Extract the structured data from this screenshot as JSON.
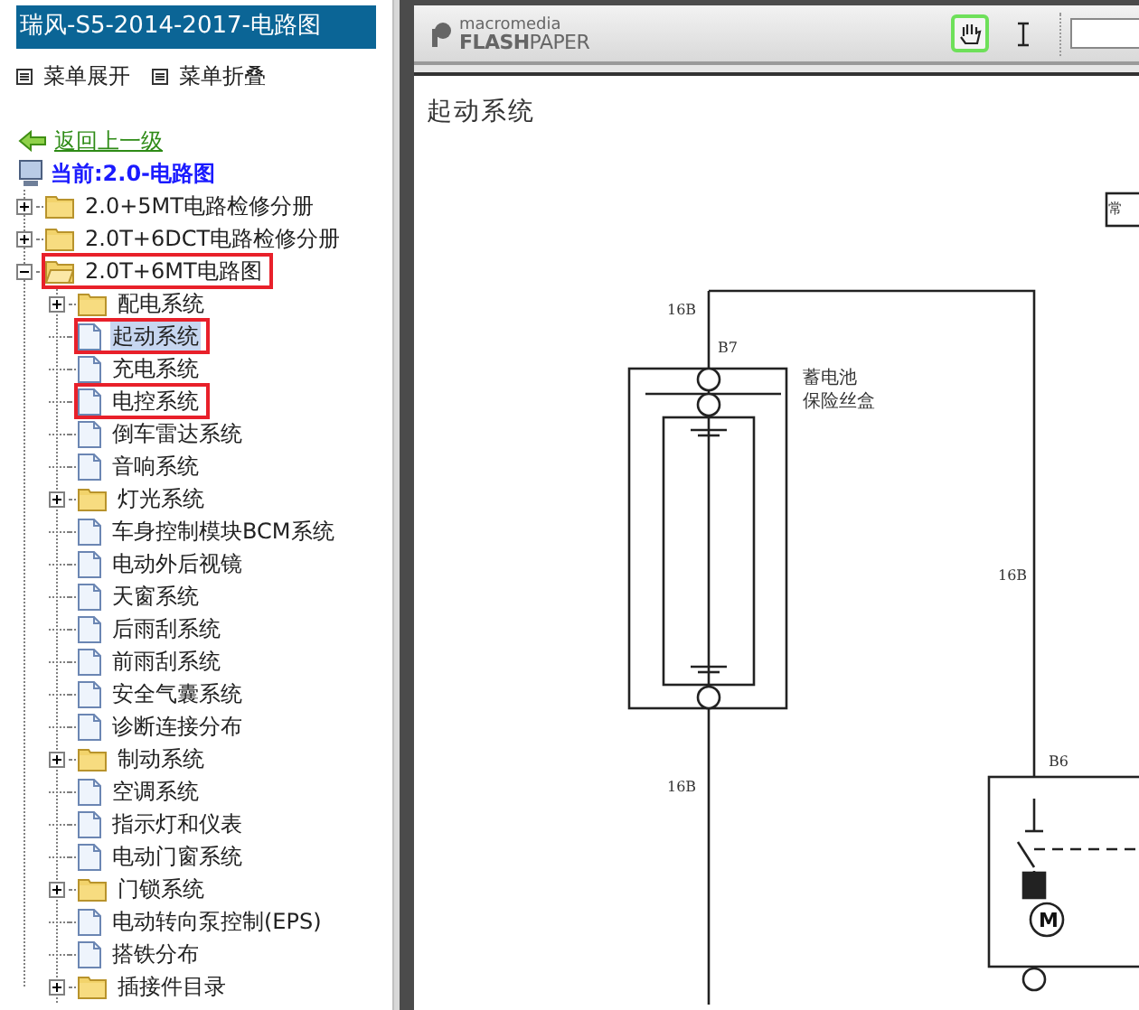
{
  "sidebar": {
    "title": "瑞风-S5-2014-2017-电路图",
    "menu": [
      {
        "label": "菜单展开"
      },
      {
        "label": "菜单折叠"
      }
    ],
    "back_link": "返回上一级",
    "current": "当前:2.0-电路图",
    "tree": [
      {
        "label": "2.0+5MT电路检修分册",
        "kind": "folder",
        "expanded": false,
        "selected": false,
        "boxed": false
      },
      {
        "label": "2.0T+6DCT电路检修分册",
        "kind": "folder",
        "expanded": false,
        "selected": false,
        "boxed": false
      },
      {
        "label": "2.0T+6MT电路图",
        "kind": "folder",
        "expanded": true,
        "selected": false,
        "boxed": true,
        "children": [
          {
            "label": "配电系统",
            "kind": "folder",
            "expanded": false,
            "selected": false,
            "boxed": false
          },
          {
            "label": "起动系统",
            "kind": "file",
            "selected": true,
            "boxed": true
          },
          {
            "label": "充电系统",
            "kind": "file",
            "selected": false,
            "boxed": false
          },
          {
            "label": "电控系统",
            "kind": "file",
            "selected": false,
            "boxed": true
          },
          {
            "label": "倒车雷达系统",
            "kind": "file",
            "selected": false,
            "boxed": false
          },
          {
            "label": "音响系统",
            "kind": "file",
            "selected": false,
            "boxed": false
          },
          {
            "label": "灯光系统",
            "kind": "folder",
            "expanded": false,
            "selected": false,
            "boxed": false
          },
          {
            "label": "车身控制模块BCM系统",
            "kind": "file",
            "selected": false,
            "boxed": false
          },
          {
            "label": "电动外后视镜",
            "kind": "file",
            "selected": false,
            "boxed": false
          },
          {
            "label": "天窗系统",
            "kind": "file",
            "selected": false,
            "boxed": false
          },
          {
            "label": "后雨刮系统",
            "kind": "file",
            "selected": false,
            "boxed": false
          },
          {
            "label": "前雨刮系统",
            "kind": "file",
            "selected": false,
            "boxed": false
          },
          {
            "label": "安全气囊系统",
            "kind": "file",
            "selected": false,
            "boxed": false
          },
          {
            "label": "诊断连接分布",
            "kind": "file",
            "selected": false,
            "boxed": false
          },
          {
            "label": "制动系统",
            "kind": "folder",
            "expanded": false,
            "selected": false,
            "boxed": false
          },
          {
            "label": "空调系统",
            "kind": "file",
            "selected": false,
            "boxed": false
          },
          {
            "label": "指示灯和仪表",
            "kind": "file",
            "selected": false,
            "boxed": false
          },
          {
            "label": "电动门窗系统",
            "kind": "file",
            "selected": false,
            "boxed": false
          },
          {
            "label": "门锁系统",
            "kind": "folder",
            "expanded": false,
            "selected": false,
            "boxed": false
          },
          {
            "label": "电动转向泵控制(EPS)",
            "kind": "file",
            "selected": false,
            "boxed": false
          },
          {
            "label": "搭铁分布",
            "kind": "file",
            "selected": false,
            "boxed": false
          },
          {
            "label": "插接件目录",
            "kind": "folder",
            "expanded": false,
            "selected": false,
            "boxed": false
          }
        ]
      }
    ]
  },
  "viewer": {
    "logo_top": "macromedia",
    "logo_bottom_bold": "FLASH",
    "logo_bottom": "PAPER",
    "tools": [
      {
        "kind": "hand",
        "selected": true
      },
      {
        "kind": "text",
        "selected": false
      }
    ],
    "document": {
      "title": "起动系统",
      "labels": [
        {
          "text": "16B",
          "kind": "wire"
        },
        {
          "text": "B7",
          "kind": "connector"
        },
        {
          "text": "蓄电池",
          "kind": "note"
        },
        {
          "text": "保险丝盒",
          "kind": "note"
        },
        {
          "text": "16B",
          "kind": "wire"
        },
        {
          "text": "16B",
          "kind": "wire"
        },
        {
          "text": "B6",
          "kind": "connector"
        },
        {
          "text": "常",
          "kind": "tag"
        }
      ],
      "motor_label": "M"
    }
  }
}
